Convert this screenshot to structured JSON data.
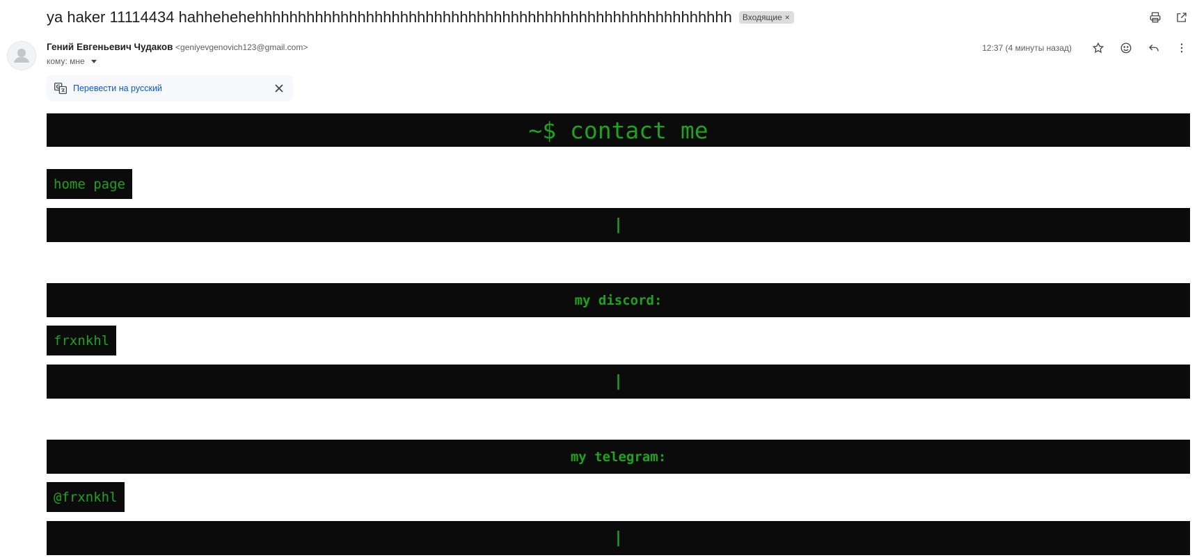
{
  "subject": "ya haker 11114434 hahhehehehhhhhhhhhhhhhhhhhhhhhhhhhhhhhhhhhhhhhhhhhhhhhhhhhhhhhhhh",
  "label": {
    "text": "Входящие",
    "close": "×"
  },
  "sender": {
    "name": "Гений Евгеньевич Чудаков",
    "email": "<geniyevgenovich123@gmail.com>"
  },
  "recipient": "кому: мне",
  "timestamp": "12:37 (4 минуты назад)",
  "translate": {
    "link": "Перевести на русский"
  },
  "body": {
    "title": "~$ contact me",
    "home_link": "home page",
    "separator": "|",
    "discord_heading": "my discord:",
    "discord_value": "frxnkhl",
    "telegram_heading": "my telegram:",
    "telegram_value": "@frxnkhl"
  },
  "icons": {
    "print": "print-icon",
    "open_new_window": "open-in-new-window-icon",
    "star": "star-icon",
    "emoji": "emoji-icon",
    "reply": "reply-icon",
    "more": "more-vert-icon",
    "translate": "translate-icon",
    "close": "close-icon"
  },
  "colors": {
    "terminal_bg": "#0b0b0b",
    "terminal_green": "#1ea31e",
    "link_blue": "#0b57d0",
    "translate_bg": "#f6f8fc"
  }
}
